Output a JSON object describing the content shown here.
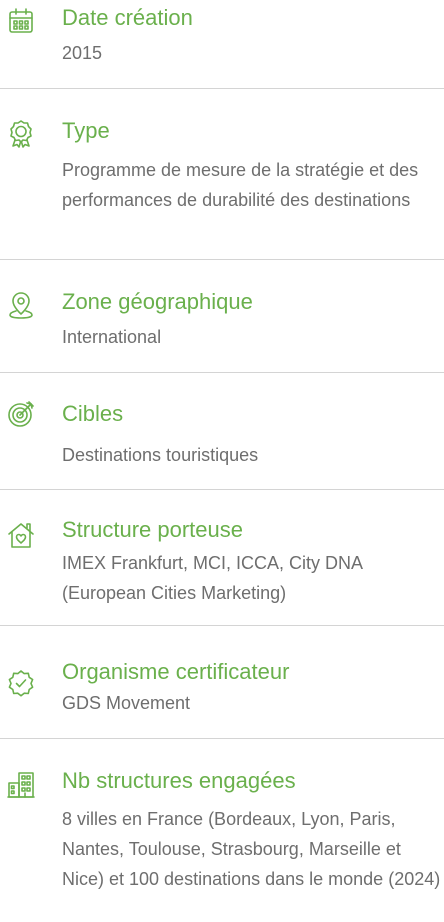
{
  "accent_color": "#6ab04c",
  "items": [
    {
      "icon": "calendar-icon",
      "title": "Date création",
      "value": "2015"
    },
    {
      "icon": "badge-icon",
      "title": "Type",
      "value": "Programme de mesure de la stratégie et des performances de durabilité des destinations"
    },
    {
      "icon": "location-pin-icon",
      "title": "Zone géographique",
      "value": "International"
    },
    {
      "icon": "target-icon",
      "title": "Cibles",
      "value": "Destinations touristiques"
    },
    {
      "icon": "home-heart-icon",
      "title": "Structure porteuse",
      "value": "IMEX Frankfurt, MCI, ICCA, City DNA (European Cities Marketing)"
    },
    {
      "icon": "verified-badge-icon",
      "title": "Organisme certificateur",
      "value": "GDS Movement"
    },
    {
      "icon": "buildings-icon",
      "title": "Nb structures engagées",
      "value": "8 villes en France (Bordeaux, Lyon, Paris, Nantes, Toulouse, Strasbourg, Marseille et Nice) et 100 destinations dans le monde (2024)"
    }
  ]
}
